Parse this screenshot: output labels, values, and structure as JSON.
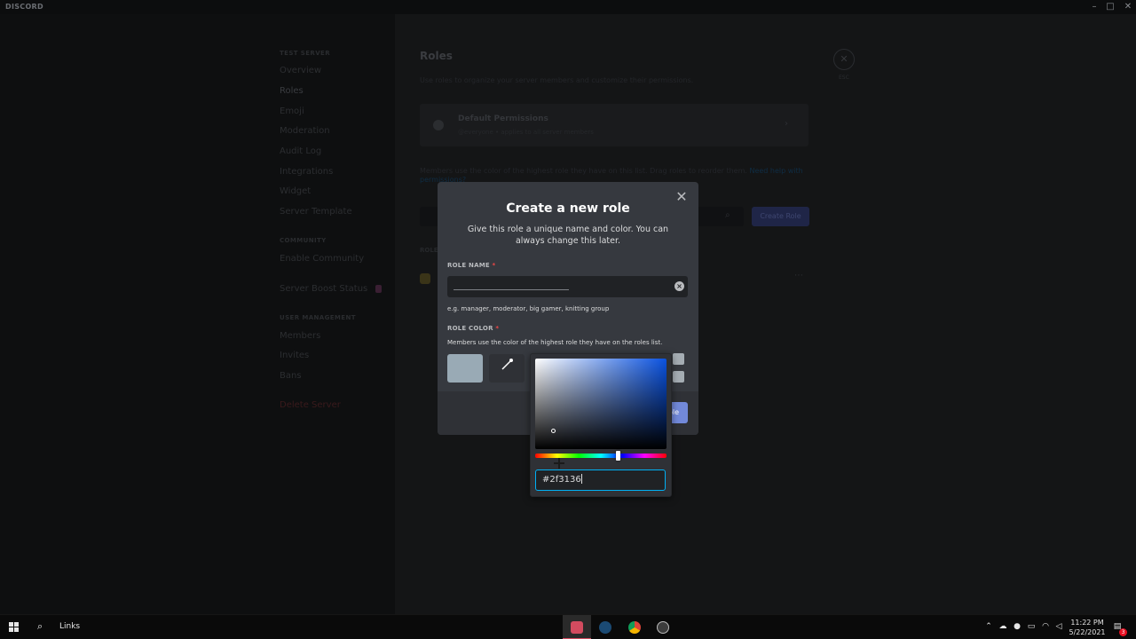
{
  "window": {
    "app_name": "DISCORD",
    "minimize": "–",
    "maximize": "□",
    "close": "✕"
  },
  "sidebar": {
    "server_header": "TEST SERVER",
    "items": [
      {
        "label": "Overview"
      },
      {
        "label": "Roles"
      },
      {
        "label": "Emoji"
      },
      {
        "label": "Moderation"
      },
      {
        "label": "Audit Log"
      },
      {
        "label": "Integrations"
      },
      {
        "label": "Widget"
      },
      {
        "label": "Server Template"
      }
    ],
    "community_header": "COMMUNITY",
    "community_items": [
      {
        "label": "Enable Community"
      }
    ],
    "boost_label": "Server Boost Status",
    "user_mgmt_header": "USER MANAGEMENT",
    "user_mgmt_items": [
      {
        "label": "Members"
      },
      {
        "label": "Invites"
      },
      {
        "label": "Bans"
      }
    ],
    "delete_label": "Delete Server"
  },
  "roles_page": {
    "title": "Roles",
    "subtitle": "Use roles to organize your server members and customize their permissions.",
    "close_label": "ESC",
    "default_card": {
      "title": "Default Permissions",
      "subtitle": "@everyone • applies to all server members"
    },
    "members_note": "Members use the color of the highest role they have on this list. Drag roles to reorder them.",
    "help_link": "Need help with permissions?",
    "create_role_label": "Create Role",
    "roles_header": "ROLES"
  },
  "modal": {
    "title": "Create a new role",
    "subtitle": "Give this role a unique name and color. You can always change this later.",
    "role_name_label": "ROLE NAME",
    "required_mark": "*",
    "role_name_value": "",
    "hint": "e.g. manager, moderator, big gamer, knitting group",
    "role_color_label": "ROLE COLOR",
    "role_color_desc": "Members use the color of the highest role they have on the roles list.",
    "default_color": "#99aab5",
    "confirm_button_label": "ole"
  },
  "color_picker": {
    "hue_color": "#0a52e0",
    "hue_fraction": 0.63,
    "hex_value": "#2f3136"
  },
  "taskbar": {
    "search_label": "Links",
    "apps": [
      {
        "name": "discord",
        "color": "#d24b5f",
        "active": true
      },
      {
        "name": "steam",
        "color": "#1b4a73",
        "active": false
      },
      {
        "name": "chrome",
        "color": "#e0b23a",
        "active": false
      },
      {
        "name": "obs",
        "color": "#3c3c3c",
        "active": false
      }
    ],
    "time": "11:22 PM",
    "date": "5/22/2021",
    "notification_count": "3"
  }
}
